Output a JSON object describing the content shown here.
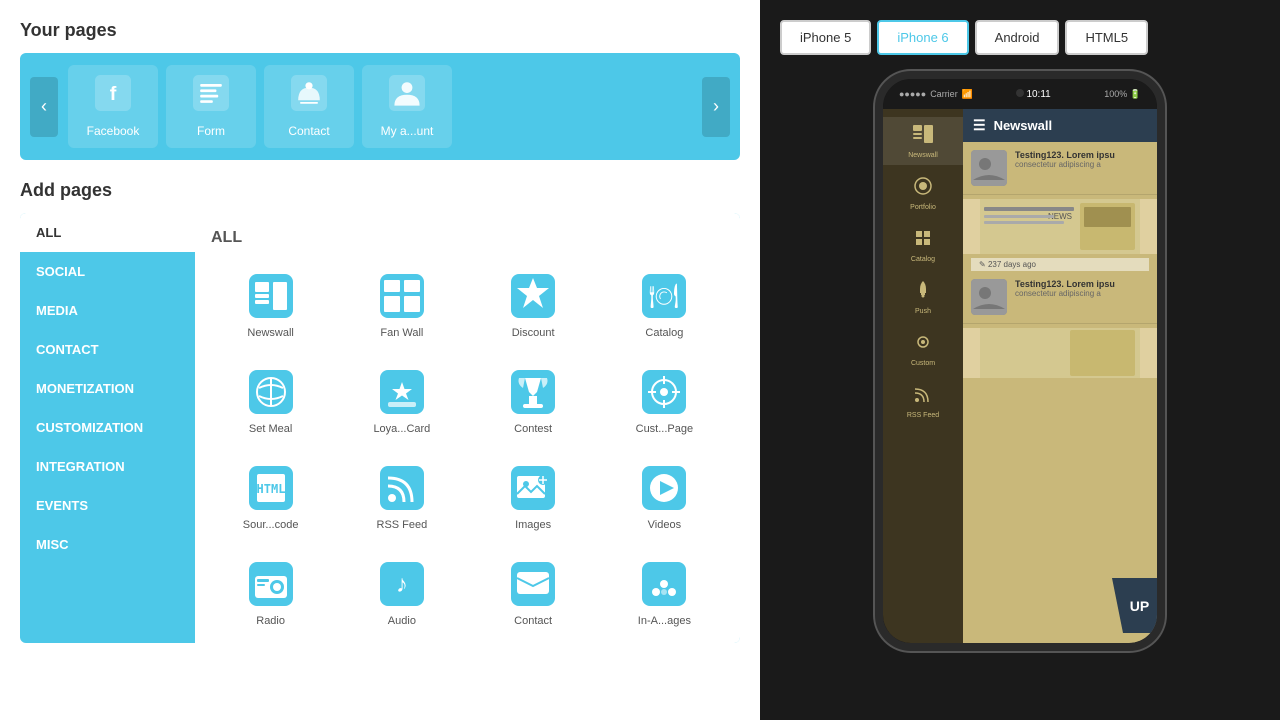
{
  "left": {
    "your_pages_title": "Your pages",
    "add_pages_title": "Add pages",
    "pages": [
      {
        "label": "Facebook",
        "icon": "facebook"
      },
      {
        "label": "Form",
        "icon": "form"
      },
      {
        "label": "Contact",
        "icon": "contact"
      },
      {
        "label": "My a...unt",
        "icon": "account"
      }
    ],
    "categories": [
      {
        "label": "ALL",
        "active": true
      },
      {
        "label": "SOCIAL",
        "active": false
      },
      {
        "label": "MEDIA",
        "active": false
      },
      {
        "label": "CONTACT",
        "active": false
      },
      {
        "label": "MONETIZATION",
        "active": false
      },
      {
        "label": "CUSTOMIZATION",
        "active": false
      },
      {
        "label": "INTEGRATION",
        "active": false
      },
      {
        "label": "EVENTS",
        "active": false
      },
      {
        "label": "MISC",
        "active": false
      }
    ],
    "content_title": "ALL",
    "app_icons": [
      {
        "label": "Newswall",
        "icon": "newswall"
      },
      {
        "label": "Fan Wall",
        "icon": "fanwall"
      },
      {
        "label": "Discount",
        "icon": "discount"
      },
      {
        "label": "Catalog",
        "icon": "catalog"
      },
      {
        "label": "Set Meal",
        "icon": "setmeal"
      },
      {
        "label": "Loya...Card",
        "icon": "loyalcard"
      },
      {
        "label": "Contest",
        "icon": "contest"
      },
      {
        "label": "Cust...Page",
        "icon": "custompage"
      },
      {
        "label": "Sour...code",
        "icon": "sourcecode"
      },
      {
        "label": "RSS Feed",
        "icon": "rssfeed"
      },
      {
        "label": "Images",
        "icon": "images"
      },
      {
        "label": "Videos",
        "icon": "videos"
      },
      {
        "label": "Radio",
        "icon": "radio"
      },
      {
        "label": "Audio",
        "icon": "audio"
      },
      {
        "label": "Contact",
        "icon": "contact2"
      },
      {
        "label": "In-A...ages",
        "icon": "inapp"
      }
    ]
  },
  "right": {
    "device_buttons": [
      {
        "label": "iPhone 5",
        "active": false
      },
      {
        "label": "iPhone 6",
        "active": true
      },
      {
        "label": "Android",
        "active": false
      },
      {
        "label": "HTML5",
        "active": false
      }
    ],
    "phone": {
      "status_signal": "●●●●●",
      "carrier": "Carrier",
      "time": "10:11",
      "sidebar_items": [
        {
          "label": "Newswall",
          "icon": "newswall"
        },
        {
          "label": "Portfolio",
          "icon": "portfolio"
        },
        {
          "label": "Catalog",
          "icon": "catalog"
        },
        {
          "label": "Push",
          "icon": "push"
        },
        {
          "label": "Custom",
          "icon": "custom"
        },
        {
          "label": "RSS Feed",
          "icon": "rss"
        }
      ],
      "header_title": "Newswall",
      "news_items": [
        {
          "title": "Testing123. Lorem ipsu",
          "desc": "consectetur adipiscing a",
          "has_image": false,
          "timestamp": null
        },
        {
          "title": null,
          "desc": null,
          "has_image": true,
          "timestamp": "237 days ago"
        },
        {
          "title": "Testing123. Lorem ipsu",
          "desc": "consectetur adipiscing a",
          "has_image": false,
          "timestamp": null
        }
      ],
      "up_label": "UP"
    }
  }
}
